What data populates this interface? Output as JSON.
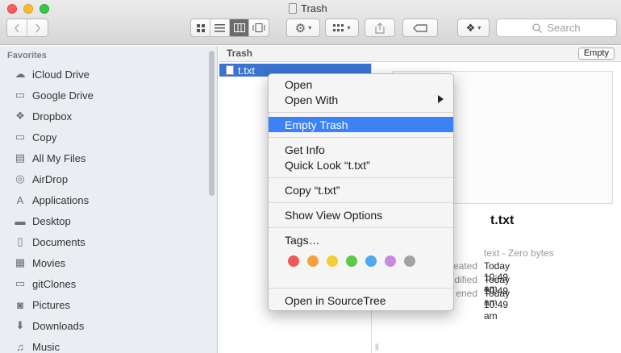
{
  "window": {
    "title": "Trash"
  },
  "toolbar": {
    "search_placeholder": "Search",
    "view_modes": [
      "icon-view",
      "list-view",
      "column-view",
      "cover-flow-view"
    ],
    "active_view": "column-view"
  },
  "sidebar": {
    "section": "Favorites",
    "items": [
      {
        "label": "iCloud Drive",
        "icon": "cloud-icon"
      },
      {
        "label": "Google Drive",
        "icon": "folder-icon"
      },
      {
        "label": "Dropbox",
        "icon": "dropbox-icon"
      },
      {
        "label": "Copy",
        "icon": "folder-icon"
      },
      {
        "label": "All My Files",
        "icon": "files-icon"
      },
      {
        "label": "AirDrop",
        "icon": "airdrop-icon"
      },
      {
        "label": "Applications",
        "icon": "applications-icon"
      },
      {
        "label": "Desktop",
        "icon": "desktop-icon"
      },
      {
        "label": "Documents",
        "icon": "documents-icon"
      },
      {
        "label": "Movies",
        "icon": "movies-icon"
      },
      {
        "label": "gitClones",
        "icon": "folder-icon"
      },
      {
        "label": "Pictures",
        "icon": "pictures-icon"
      },
      {
        "label": "Downloads",
        "icon": "downloads-icon"
      },
      {
        "label": "Music",
        "icon": "music-icon"
      }
    ]
  },
  "path_bar": {
    "title": "Trash",
    "empty_label": "Empty"
  },
  "file": {
    "name": "t.txt"
  },
  "preview": {
    "name": "t.txt",
    "kind": "text - Zero bytes",
    "rows": [
      {
        "label": "eated",
        "value": "Today 10:49 am"
      },
      {
        "label": "dified",
        "value": "Today 10:49 am"
      },
      {
        "label": "ened",
        "value": "Today 10:49 am"
      }
    ]
  },
  "context_menu": {
    "open": "Open",
    "open_with": "Open With",
    "empty_trash": "Empty Trash",
    "get_info": "Get Info",
    "quick_look": "Quick Look “t.txt”",
    "copy": "Copy “t.txt”",
    "show_view_options": "Show View Options",
    "tags": "Tags…",
    "tag_colors": [
      "#ec5a57",
      "#f5a13d",
      "#f7cd36",
      "#5fc84b",
      "#4aa9f2",
      "#c98ae0",
      "#a3a3a3"
    ],
    "open_in_sourcetree": "Open in SourceTree"
  }
}
